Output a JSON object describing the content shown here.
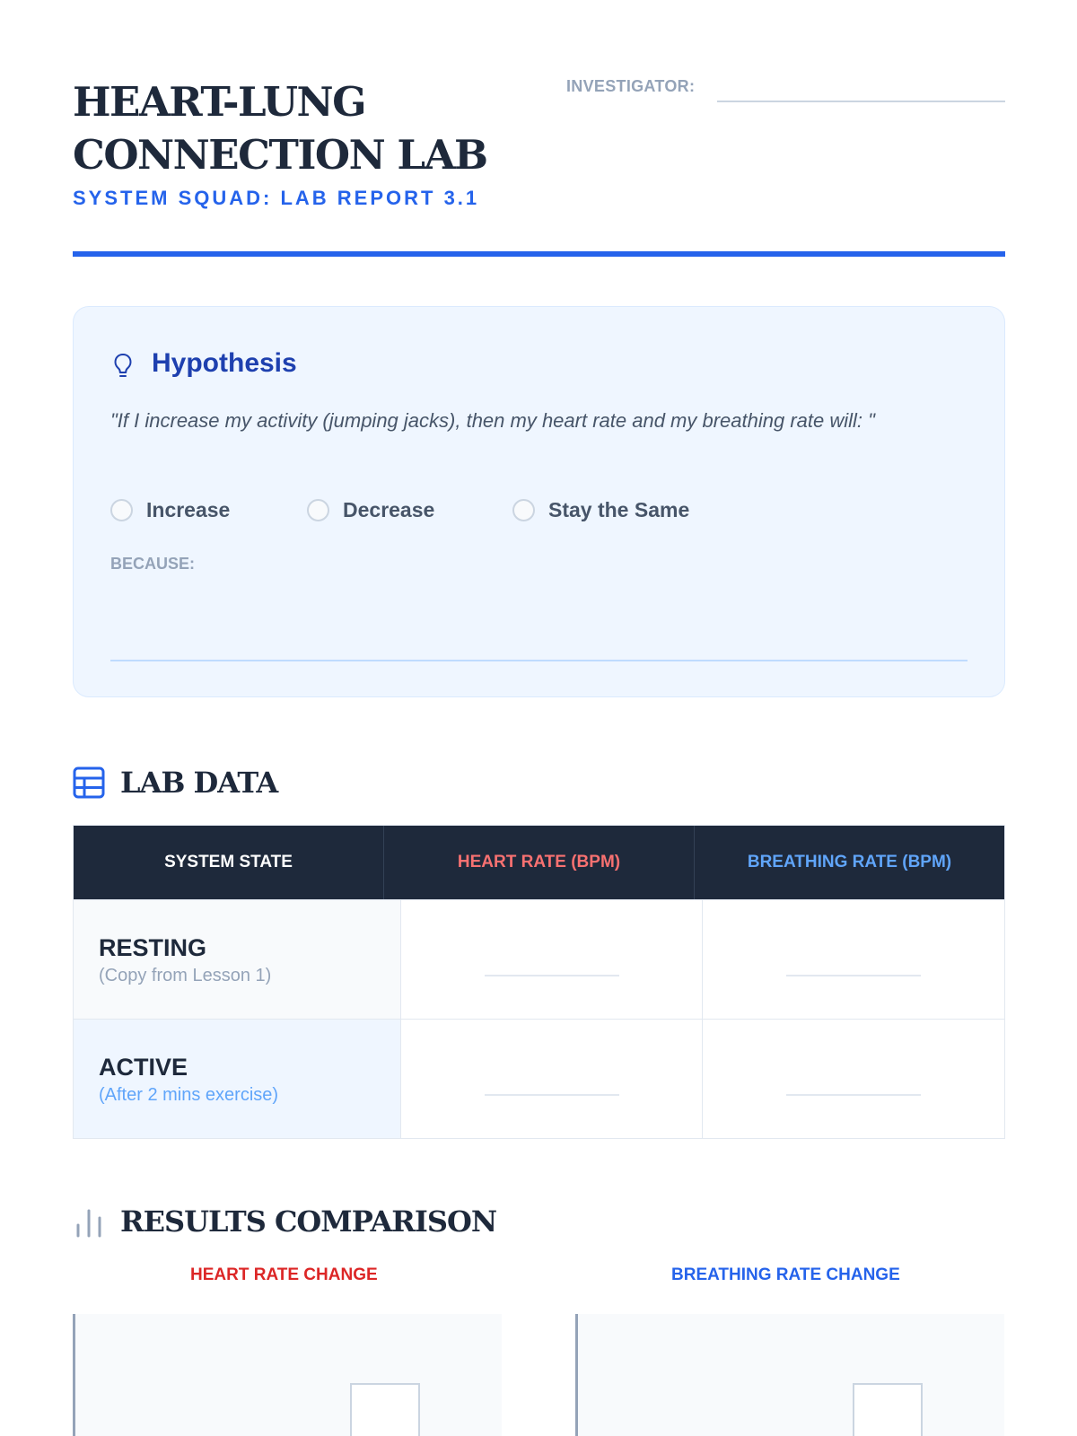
{
  "header": {
    "title": "HEART-LUNG CONNECTION LAB",
    "subtitle": "SYSTEM SQUAD: LAB REPORT 3.1",
    "investigator_label": "INVESTIGATOR:",
    "investigator_value": ""
  },
  "hypothesis": {
    "icon": "lightbulb-icon",
    "title": "Hypothesis",
    "statement": "\"If I increase my activity (jumping jacks), then my heart rate and my breathing rate will: \"",
    "options": [
      "Increase",
      "Decrease",
      "Stay the Same"
    ],
    "because_label": "BECAUSE:",
    "because_value": ""
  },
  "lab_data": {
    "icon": "table-icon",
    "title": "LAB DATA",
    "columns": [
      "SYSTEM STATE",
      "HEART RATE (BPM)",
      "BREATHING RATE (BPM)"
    ],
    "rows": [
      {
        "state": "RESTING",
        "note": "(Copy from Lesson 1)",
        "heart_rate": "",
        "breathing_rate": ""
      },
      {
        "state": "ACTIVE",
        "note": "(After 2 mins exercise)",
        "heart_rate": "",
        "breathing_rate": ""
      }
    ]
  },
  "results": {
    "icon": "bar-chart-icon",
    "title": "RESULTS COMPARISON",
    "heart_chart_title": "HEART RATE CHANGE",
    "breathing_chart_title": "BREATHING RATE CHANGE"
  },
  "colors": {
    "accent": "#2563eb",
    "heart": "#ef4444",
    "breathing": "#3b82f6",
    "header_bg": "#1e293b"
  }
}
